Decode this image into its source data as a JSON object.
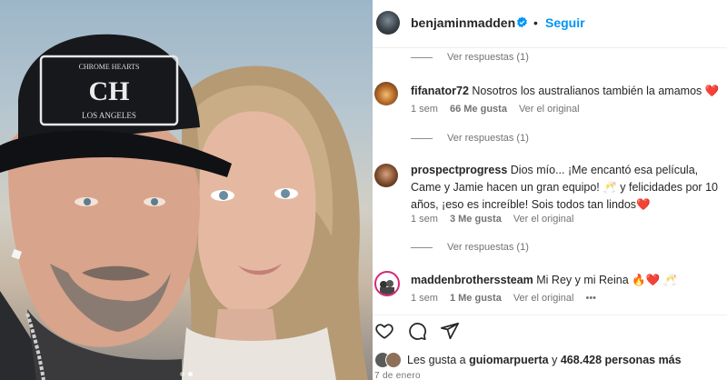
{
  "post": {
    "username": "benjaminmadden",
    "separator": "•",
    "follow_label": "Seguir",
    "verified_color": "#0095f6"
  },
  "photo": {
    "carousel_total": 2,
    "carousel_active": 2
  },
  "thread": {
    "replies_top": "Ver respuestas (1)",
    "comments": [
      {
        "username": "fifanator72",
        "text": "Nosotros los australianos también la amamos ❤️",
        "time": "1 sem",
        "likes": "66 Me gusta",
        "see_original": "Ver el original",
        "replies": "Ver respuestas (1)"
      },
      {
        "username": "prospectprogress",
        "text": "Dios mío... ¡Me encantó esa película, Came y Jamie hacen un gran equipo! 🥂 y felicidades por 10 años, ¡eso es increíble! Sois todos tan lindos❤️",
        "time": "1 sem",
        "likes": "3 Me gusta",
        "see_original": "Ver el original",
        "replies": "Ver respuestas (1)"
      },
      {
        "username": "maddenbrotherssteam",
        "text": "Mi Rey y mi Reina 🔥❤️ 🥂",
        "time": "1 sem",
        "likes": "1 Me gusta",
        "see_original": "Ver el original",
        "more": "•••"
      }
    ]
  },
  "footer": {
    "likes_prefix": "Les gusta a",
    "liker": "guiomarpuerta",
    "likes_mid": "y",
    "likes_count": "468.428 personas más",
    "date": "7 de enero"
  }
}
